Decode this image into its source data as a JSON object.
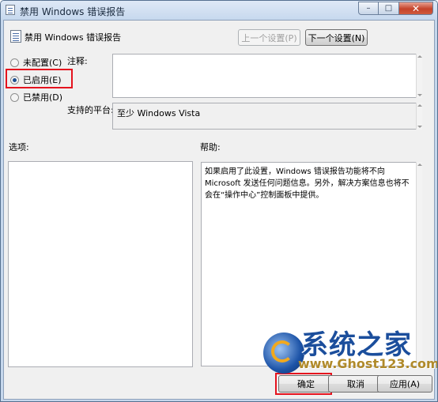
{
  "window": {
    "title": "禁用 Windows 错误报告",
    "minimize": "–",
    "maximize": "□",
    "close": "✕"
  },
  "header": {
    "policy_name": "禁用 Windows 错误报告",
    "prev_label": "上一个设置(P)",
    "next_label": "下一个设置(N)"
  },
  "state": {
    "options": [
      {
        "label": "未配置(C)",
        "checked": false
      },
      {
        "label": "已启用(E)",
        "checked": true
      },
      {
        "label": "已禁用(D)",
        "checked": false
      }
    ],
    "highlight_color": "#e5131e"
  },
  "comment": {
    "label": "注释:",
    "value": ""
  },
  "platform": {
    "label": "支持的平台:",
    "value": "至少 Windows Vista"
  },
  "options_panel": {
    "label": "选项:"
  },
  "help_panel": {
    "label": "帮助:",
    "text": "如果启用了此设置，Windows 错误报告功能将不向 Microsoft 发送任何问题信息。另外，解决方案信息也将不会在“操作中心”控制面板中提供。"
  },
  "buttons": {
    "ok": "确定",
    "cancel": "取消",
    "apply": "应用(A)"
  },
  "watermark": {
    "text_cn": "系统之家",
    "text_en": "www.Ghost123.com"
  }
}
